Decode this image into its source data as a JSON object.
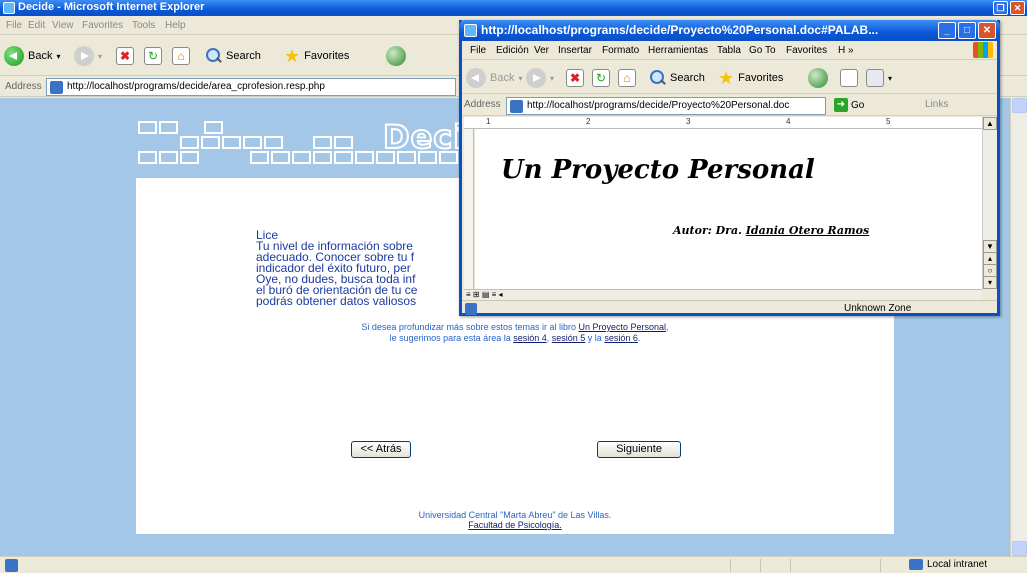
{
  "main_window": {
    "title": "Decide - Microsoft Internet Explorer",
    "menu": [
      "File",
      "Edit",
      "View",
      "Favorites",
      "Tools",
      "Help"
    ],
    "toolbar": {
      "back": "Back",
      "search": "Search",
      "favorites": "Favorites"
    },
    "address_label": "Address",
    "address_url": "http://localhost/programs/decide/area_cprofesion.resp.php",
    "logo_text": "Deci",
    "message_lines": [
      "Lice",
      "Tu nivel de información sobre",
      "adecuado. Conocer sobre tu f",
      "indicador del éxito futuro, per",
      "Oye, no dudes, busca toda inf",
      "el buró de orientación de tu ce",
      "podrás obtener datos valiosos"
    ],
    "suggest": {
      "line1_prefix": "Si desea profundizar más sobre estos temas ir al libro ",
      "book_link": "Un Proyecto Personal",
      "line1_suffix": ",",
      "line2_prefix": "le sugerimos para esta área la ",
      "session4": "sesión 4",
      "sep1": ", ",
      "session5": "sesión 5",
      "sep2": " y la ",
      "session6": "sesión 6",
      "line2_suffix": "."
    },
    "back_button": "<< Atrás",
    "next_button": "Siguiente",
    "footer_line1": "Universidad Central \"Marta Abreu\" de Las Villas.",
    "footer_link": "Facultad de Psicología.",
    "status_zone": "Local intranet"
  },
  "popup_window": {
    "title": "http://localhost/programs/decide/Proyecto%20Personal.doc#PALAB...",
    "menu": [
      "File",
      "Edición",
      "Ver",
      "Insertar",
      "Formato",
      "Herramientas",
      "Tabla",
      "Go To",
      "Favorites",
      "H",
      "»"
    ],
    "toolbar": {
      "back": "Back",
      "search": "Search",
      "favorites": "Favorites"
    },
    "address_label": "Address",
    "address_url": "http://localhost/programs/decide/Proyecto%20Personal.doc",
    "go_label": "Go",
    "links_label": "Links",
    "doc_title": "Un Proyecto Personal",
    "doc_author_prefix": "Autor: Dra. ",
    "doc_author_name": "Idania Otero Ramos",
    "ruler_numbers": [
      "1",
      "2",
      "3",
      "4",
      "5"
    ],
    "status_zone": "Unknown Zone"
  }
}
